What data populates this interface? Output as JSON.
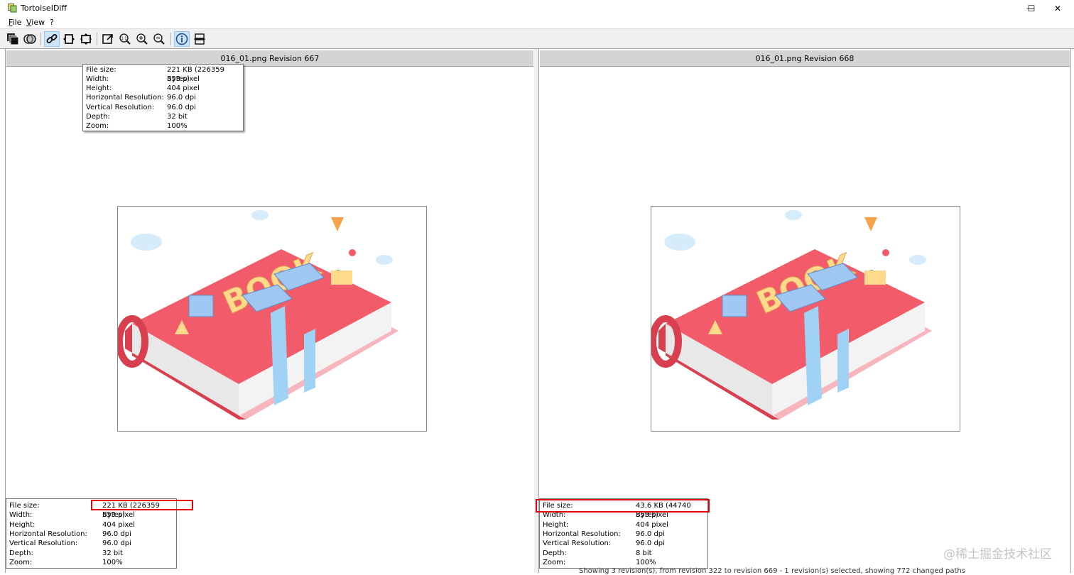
{
  "window": {
    "title": "TortoiseIDiff",
    "minimize_glyph": "—",
    "maximize_glyph": "☐",
    "close_glyph": "✕"
  },
  "menu": [
    {
      "label": "File",
      "underline": "F",
      "rest": "ile"
    },
    {
      "label": "View",
      "underline": "V",
      "rest": "iew"
    },
    {
      "label": "?",
      "underline": "",
      "rest": "?"
    }
  ],
  "toolbar": [
    {
      "name": "overlap-mode-icon",
      "active": false
    },
    {
      "name": "blend-mode-icon",
      "active": false
    },
    {
      "name": "link-images-icon",
      "active": true
    },
    {
      "name": "fit-width-icon",
      "active": false
    },
    {
      "name": "fit-height-icon",
      "active": false
    },
    {
      "name": "fit-window-icon",
      "active": false
    },
    {
      "name": "original-size-icon",
      "active": false
    },
    {
      "name": "zoom-in-icon",
      "active": false
    },
    {
      "name": "zoom-out-icon",
      "active": false
    },
    {
      "name": "image-info-icon",
      "active": true
    },
    {
      "name": "vertical-layout-icon",
      "active": false
    }
  ],
  "info_labels": {
    "file_size": "File size:",
    "width": "Width:",
    "height": "Height:",
    "hres": "Horizontal Resolution:",
    "vres": "Vertical Resolution:",
    "depth": "Depth:",
    "zoom": "Zoom:"
  },
  "left": {
    "title": "016_01.png Revision 667",
    "info": {
      "file_size": "221 KB (226359 Bytes)",
      "width": "553 pixel",
      "height": "404 pixel",
      "hres": "96.0 dpi",
      "vres": "96.0 dpi",
      "depth": "32 bit",
      "zoom": "100%"
    }
  },
  "right": {
    "title": "016_01.png Revision 668",
    "info": {
      "file_size": "43.6 KB (44740 Bytes)",
      "width": "553 pixel",
      "height": "404 pixel",
      "hres": "96.0 dpi",
      "vres": "96.0 dpi",
      "depth": "8 bit",
      "zoom": "100%"
    }
  },
  "image_art": {
    "word": "BOOK",
    "colors": {
      "cover": "#f25b6a",
      "cover_dark": "#d9404f",
      "pages": "#f3f3f3",
      "river": "#9fd2f5",
      "letters": "#ffd98c",
      "cloud": "#d6ecfb"
    }
  },
  "statusbar": "Showing 3 revision(s), from revision 322 to revision 669 - 1 revision(s) selected, showing 772 changed paths",
  "watermark": "@稀土掘金技术社区",
  "colors": {
    "highlight": "#e3000f",
    "toolbar_bg": "#f0f0f0",
    "header_bg": "#d4d4d4"
  }
}
